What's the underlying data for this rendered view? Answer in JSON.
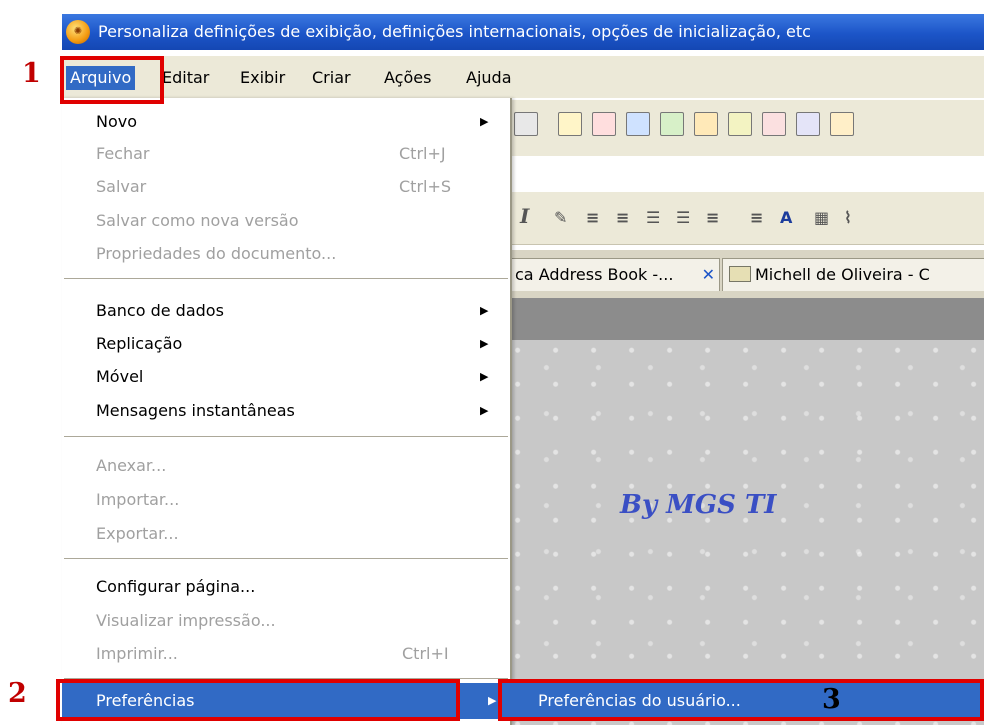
{
  "window": {
    "title": "Personaliza definições de exibição, definições internacionais, opções de inicialização, etc"
  },
  "menubar": {
    "items": [
      {
        "label": "Arquivo"
      },
      {
        "label": "Editar"
      },
      {
        "label": "Exibir"
      },
      {
        "label": "Criar"
      },
      {
        "label": "Ações"
      },
      {
        "label": "Ajuda"
      }
    ]
  },
  "tabs": [
    {
      "label": "ca Address Book -..."
    },
    {
      "label": "Michell de Oliveira - C"
    }
  ],
  "watermark": "By MGS TI",
  "file_menu": {
    "novo": {
      "label": "Novo"
    },
    "fechar": {
      "label": "Fechar",
      "shortcut": "Ctrl+J"
    },
    "salvar": {
      "label": "Salvar",
      "shortcut": "Ctrl+S"
    },
    "salvar_nova_versao": {
      "label": "Salvar como nova versão"
    },
    "propriedades": {
      "label": "Propriedades do documento..."
    },
    "banco_de_dados": {
      "label": "Banco de dados"
    },
    "replicacao": {
      "label": "Replicação"
    },
    "movel": {
      "label": "Móvel"
    },
    "mensagens": {
      "label": "Mensagens instantâneas"
    },
    "anexar": {
      "label": "Anexar..."
    },
    "importar": {
      "label": "Importar..."
    },
    "exportar": {
      "label": "Exportar..."
    },
    "configurar_pagina": {
      "label": "Configurar página..."
    },
    "visualizar_impressao": {
      "label": "Visualizar impressão..."
    },
    "imprimir": {
      "label": "Imprimir...",
      "shortcut": "Ctrl+I"
    },
    "preferencias": {
      "label": "Preferências"
    }
  },
  "submenu": {
    "preferencias_usuario": {
      "label": "Preferências do usuário..."
    }
  },
  "annotations": {
    "step1": "1",
    "step2": "2",
    "step3": "3"
  },
  "colors": {
    "highlight": "#316ac5",
    "annotation_red": "#e00000",
    "menu_bg": "#ece9d8"
  }
}
